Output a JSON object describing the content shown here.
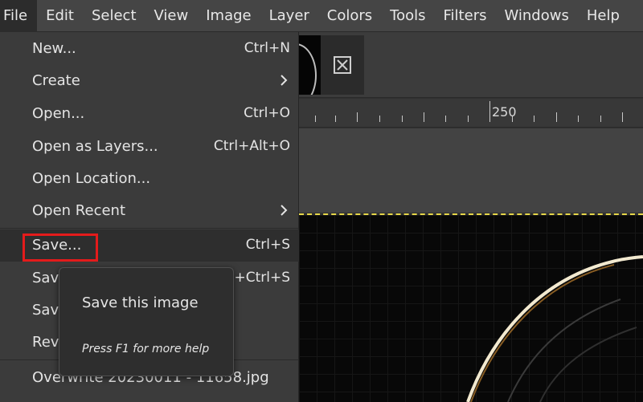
{
  "menubar": {
    "items": [
      "File",
      "Edit",
      "Select",
      "View",
      "Image",
      "Layer",
      "Colors",
      "Tools",
      "Filters",
      "Windows",
      "Help"
    ]
  },
  "file_menu": {
    "items": [
      {
        "label": "New...",
        "shortcut": "Ctrl+N"
      },
      {
        "label": "Create",
        "shortcut": ""
      },
      {
        "label": "Open...",
        "shortcut": "Ctrl+O"
      },
      {
        "label": "Open as Layers...",
        "shortcut": "Ctrl+Alt+O"
      },
      {
        "label": "Open Location...",
        "shortcut": ""
      },
      {
        "label": "Open Recent",
        "shortcut": ""
      },
      {
        "label": "Save...",
        "shortcut": "Ctrl+S"
      },
      {
        "label": "Save",
        "shortcut": "t+Ctrl+S"
      },
      {
        "label": "Save",
        "shortcut": ""
      },
      {
        "label": "Rev",
        "shortcut": ""
      },
      {
        "label": "Overwrite 20230011 - 11658.jpg",
        "shortcut": ""
      }
    ]
  },
  "tooltip": {
    "title": "Save this image",
    "help": "Press F1 for more help"
  },
  "ruler": {
    "label": "250"
  },
  "icons": {
    "submenu_arrow": "chevron-right-icon",
    "close_tab": "close-icon"
  },
  "colors": {
    "highlight": "#e41b1b",
    "selection": "#e8d84a"
  }
}
